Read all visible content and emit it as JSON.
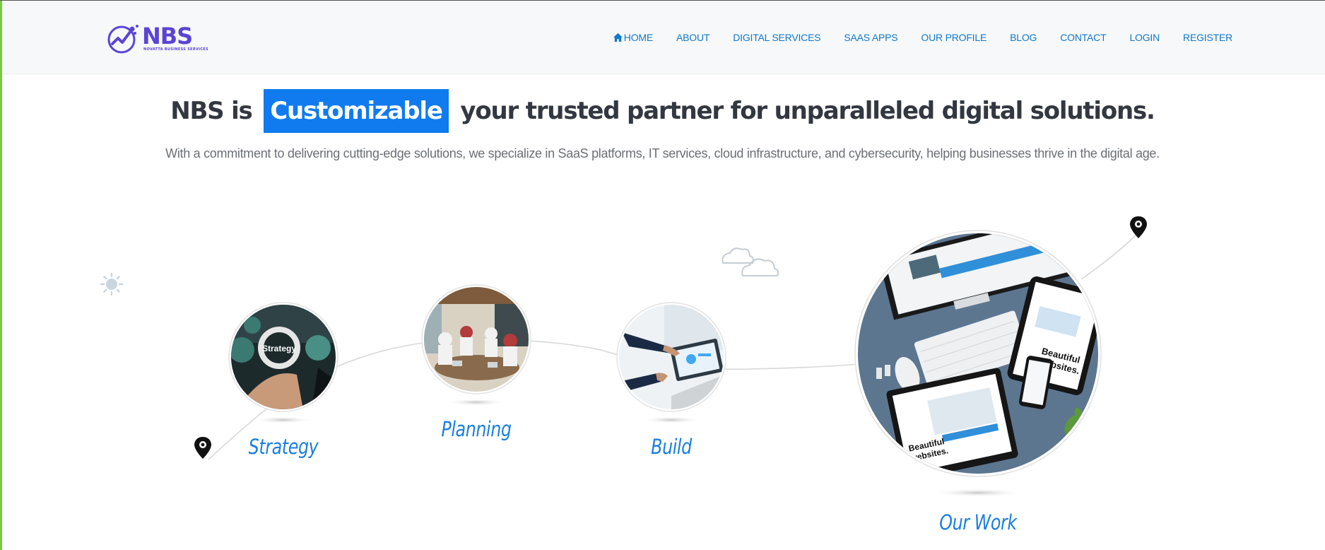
{
  "brand": {
    "logo_text": "NBS",
    "logo_subtext": "NOVATTA BUSINESS SERVICES",
    "color": "#5b43d6"
  },
  "nav": {
    "items": [
      {
        "label": "HOME",
        "icon": "home-icon"
      },
      {
        "label": "ABOUT"
      },
      {
        "label": "DIGITAL SERVICES"
      },
      {
        "label": "SAAS APPS"
      },
      {
        "label": "OUR PROFILE"
      },
      {
        "label": "BLOG"
      },
      {
        "label": "CONTACT"
      },
      {
        "label": "LOGIN"
      },
      {
        "label": "REGISTER"
      }
    ],
    "color": "#1179c9"
  },
  "hero": {
    "title_prefix": "NBS is",
    "title_highlight": "Customizable",
    "title_suffix": "your trusted partner for unparalleled digital solutions.",
    "highlight_color": "#0f7bef",
    "subtitle": "With a commitment to delivering cutting-edge solutions, we specialize in SaaS platforms, IT services, cloud infrastructure, and cybersecurity, helping businesses thrive in the digital age."
  },
  "steps": [
    {
      "label": "Strategy",
      "image": "strategy-gears-image"
    },
    {
      "label": "Planning",
      "image": "planning-meeting-image"
    },
    {
      "label": "Build",
      "image": "build-laptop-image"
    },
    {
      "label": "Our Work",
      "image": "our-work-devices-image"
    }
  ],
  "decorations": [
    "sun-icon",
    "cloud-icon",
    "map-pin-icon"
  ],
  "label_color": "#1a7fe0"
}
